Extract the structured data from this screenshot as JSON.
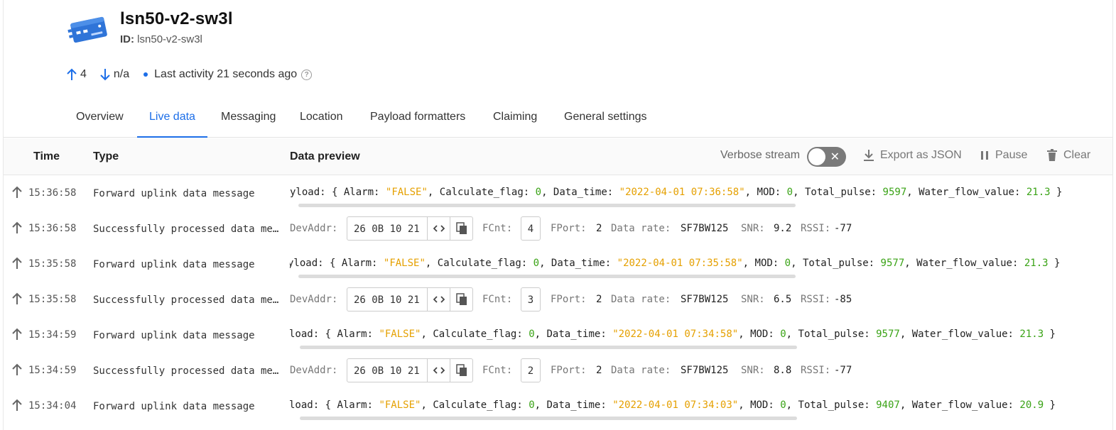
{
  "device": {
    "name": "lsn50-v2-sw3l",
    "id_label": "ID:",
    "id_value": "lsn50-v2-sw3l",
    "uplink_count": "4",
    "downlink_count": "n/a",
    "last_activity": "Last activity 21 seconds ago"
  },
  "tabs": [
    {
      "label": "Overview"
    },
    {
      "label": "Live data"
    },
    {
      "label": "Messaging"
    },
    {
      "label": "Location"
    },
    {
      "label": "Payload formatters"
    },
    {
      "label": "Claiming"
    },
    {
      "label": "General settings"
    }
  ],
  "table": {
    "col_time": "Time",
    "col_type": "Type",
    "col_preview": "Data preview",
    "verbose_label": "Verbose stream",
    "export_label": "Export as JSON",
    "pause_label": "Pause",
    "clear_label": "Clear"
  },
  "rows": [
    {
      "time": "15:36:58",
      "type": "Forward uplink data message",
      "prefix": "yload: ",
      "alarm": "\"FALSE\"",
      "calc": "0",
      "data_time": "\"2022-04-01 07:36:58\"",
      "mod": "0",
      "pulse": "9597",
      "flow": "21.3"
    },
    {
      "time": "15:36:58",
      "type": "Successfully processed data message",
      "devaddr": "26 0B 10 21",
      "fcnt": "4",
      "fport": "2",
      "datarate": "SF7BW125",
      "snr": "9.2",
      "rssi": "-77"
    },
    {
      "time": "15:35:58",
      "type": "Forward uplink data message",
      "prefix": "yload: ",
      "alarm": "\"FALSE\"",
      "calc": "0",
      "data_time": "\"2022-04-01 07:35:58\"",
      "mod": "0",
      "pulse": "9577",
      "flow": "21.3"
    },
    {
      "time": "15:35:58",
      "type": "Successfully processed data message",
      "devaddr": "26 0B 10 21",
      "fcnt": "3",
      "fport": "2",
      "datarate": "SF7BW125",
      "snr": "6.5",
      "rssi": "-85"
    },
    {
      "time": "15:34:59",
      "type": "Forward uplink data message",
      "prefix": "load: ",
      "alarm": "\"FALSE\"",
      "calc": "0",
      "data_time": "\"2022-04-01 07:34:58\"",
      "mod": "0",
      "pulse": "9577",
      "flow": "21.3"
    },
    {
      "time": "15:34:59",
      "type": "Successfully processed data message",
      "devaddr": "26 0B 10 21",
      "fcnt": "2",
      "fport": "2",
      "datarate": "SF7BW125",
      "snr": "8.8",
      "rssi": "-77"
    },
    {
      "time": "15:34:04",
      "type": "Forward uplink data message",
      "prefix": "load: ",
      "alarm": "\"FALSE\"",
      "calc": "0",
      "data_time": "\"2022-04-01 07:34:03\"",
      "mod": "0",
      "pulse": "9407",
      "flow": "20.9"
    }
  ],
  "labels": {
    "alarm_key": "Alarm: ",
    "calc_key": "Calculate_flag: ",
    "time_key": "Data_time: ",
    "mod_key": "MOD: ",
    "pulse_key": "Total_pulse: ",
    "flow_key": "Water_flow_value: ",
    "devaddr_key": "DevAddr:",
    "fcnt_key": "FCnt:",
    "fport_key": "FPort:",
    "datarate_key": "Data rate:",
    "snr_key": "SNR:",
    "rssi_key": "RSSI:"
  },
  "colors": {
    "accent": "#1c6ee8",
    "string_value": "#e5a000",
    "number_value": "#3aa316"
  }
}
